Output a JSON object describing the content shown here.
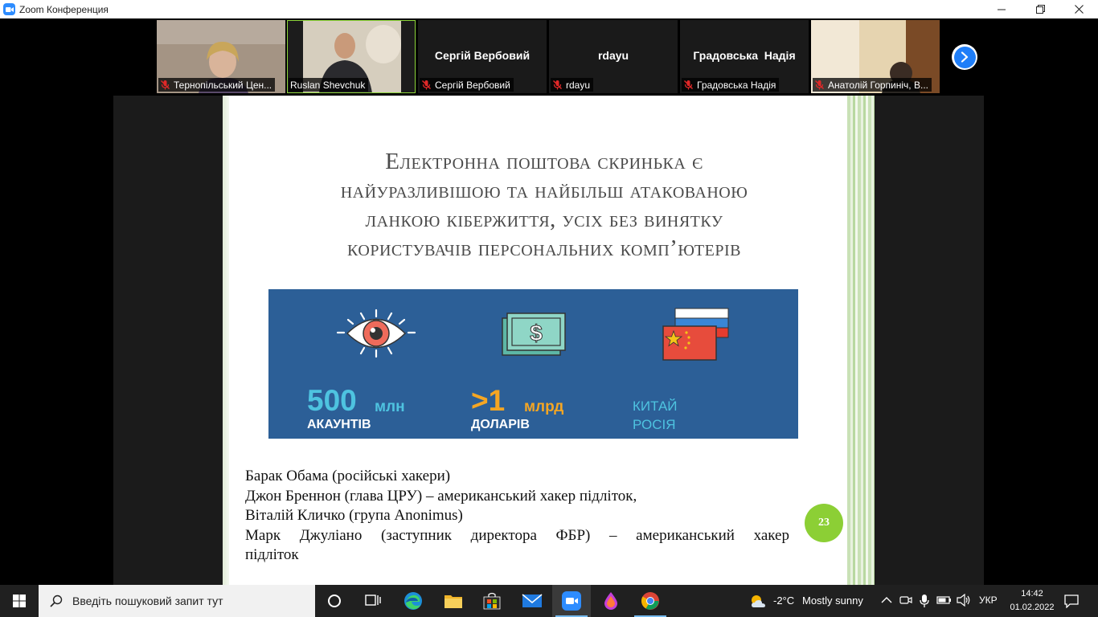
{
  "window": {
    "title": "Zoom Конференция",
    "minimize_icon": "minimize-icon",
    "restore_icon": "restore-icon",
    "close_icon": "close-icon"
  },
  "participants": [
    {
      "label": "Тернопільський Цен...",
      "big_name": "",
      "muted": true,
      "video": true
    },
    {
      "label": "Ruslan Shevchuk",
      "big_name": "",
      "muted": false,
      "video": true,
      "active_speaker": true
    },
    {
      "label": "Сергій Вербовий",
      "big_name": "Сергій Вербовий",
      "muted": true,
      "video": false
    },
    {
      "label": "rdayu",
      "big_name": "rdayu",
      "muted": true,
      "video": false
    },
    {
      "label": "Градовська Надія",
      "big_name": "Градовська  Надія",
      "muted": true,
      "video": false
    },
    {
      "label": "Анатолій Горпиніч, В...",
      "big_name": "",
      "muted": true,
      "video": true
    }
  ],
  "slide": {
    "title_lines": [
      "Електронна поштова скринька є",
      "найуразливішою та найбільш атакованою",
      "ланкою кібержиття, усіх без винятку",
      "користувачів персональних комп’ютерів"
    ],
    "stats": [
      {
        "num": "500",
        "unit": "млн",
        "sub": "АКАУНТІВ",
        "icon": "eye-icon"
      },
      {
        "num": ">1",
        "unit": "млрд",
        "sub": "ДОЛАРІВ",
        "icon": "money-icon"
      },
      {
        "num": "",
        "unit": "",
        "sub_lines": [
          "КИТАЙ",
          "РОСІЯ"
        ],
        "icon": "flags-icon"
      }
    ],
    "body_lines": [
      "Барак Обама (російські хакери)",
      "Джон Бреннон (глава ЦРУ) – американський хакер підліток,",
      "Віталій Кличко (група Anonimus)",
      "Марк Джуліано (заступник директора ФБР) – американський хакер",
      "підліток"
    ],
    "page_number": "23",
    "colors": {
      "box": "#2c5f97",
      "cyan": "#4ec3e0",
      "orange": "#f5a623",
      "badge": "#8ccf35"
    }
  },
  "taskbar": {
    "search_placeholder": "Введіть пошуковий запит тут",
    "weather_temp": "-2°C",
    "weather_desc": "Mostly sunny",
    "language": "УКР",
    "time": "14:42",
    "date": "01.02.2022",
    "apps": [
      "task-view-icon",
      "edge-icon",
      "file-explorer-icon",
      "store-icon",
      "mail-icon",
      "zoom-icon",
      "paint-icon",
      "chrome-icon"
    ]
  }
}
